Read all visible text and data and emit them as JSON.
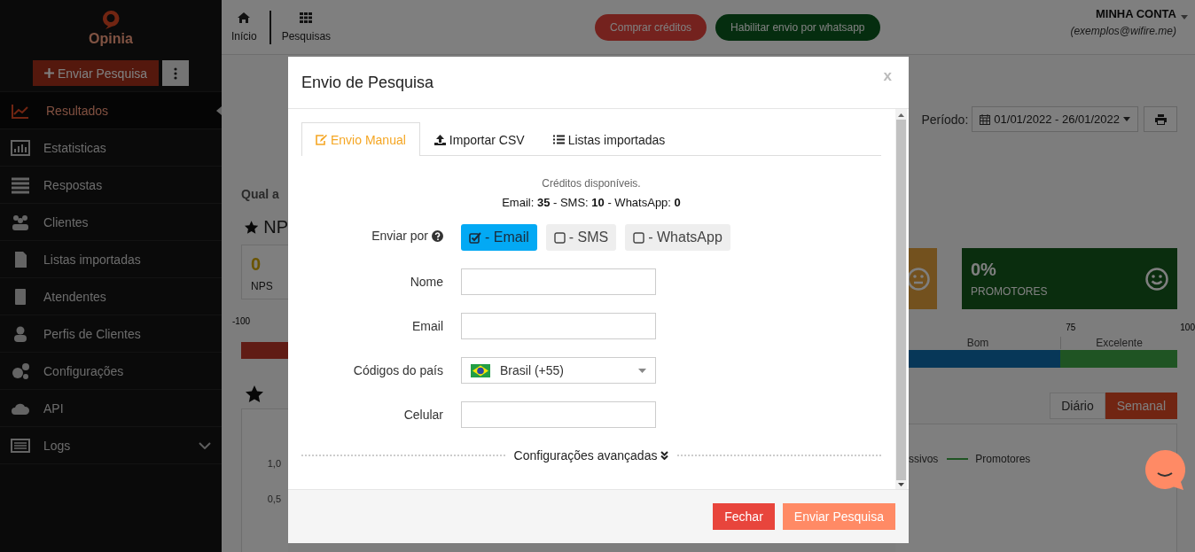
{
  "sidebar": {
    "logo": "Opinia",
    "send_button": "Enviar Pesquisa",
    "items": [
      {
        "label": "Resultados",
        "selected": true,
        "kind": "link"
      },
      {
        "label": "Estatisticas",
        "selected": false,
        "kind": "link"
      },
      {
        "label": "Respostas",
        "selected": false,
        "kind": "link"
      },
      {
        "label": "Clientes",
        "selected": false,
        "kind": "link"
      },
      {
        "label": "Listas importadas",
        "selected": false,
        "kind": "link"
      },
      {
        "label": "Atendentes",
        "selected": false,
        "kind": "link"
      },
      {
        "label": "Perfis de Clientes",
        "selected": false,
        "kind": "link"
      },
      {
        "label": "Configurações",
        "selected": false,
        "kind": "link"
      },
      {
        "label": "API",
        "selected": false,
        "kind": "link"
      },
      {
        "label": "Logs",
        "selected": false,
        "kind": "group"
      }
    ]
  },
  "topbar": {
    "nav": [
      {
        "label": "Início"
      },
      {
        "label": "Pesquisas"
      }
    ],
    "buttons": [
      {
        "label": "Comprar créditos",
        "kind": "danger"
      },
      {
        "label": "Habilitar envio por whatsapp",
        "kind": "success"
      }
    ],
    "account": {
      "title": "MINHA CONTA",
      "email": "(exemplos@wifire.me)"
    }
  },
  "page": {
    "question": "Qual a",
    "nps_heading": "NP",
    "period_label": "Período:",
    "period_value": "01/01/2022 - 26/01/2022",
    "nps_card": {
      "value": "0",
      "label": "NPS"
    },
    "promoters_card": {
      "value": "0%",
      "label": "PROMOTORES"
    },
    "scale": {
      "min": "-100",
      "ticks": [
        "75",
        "100"
      ],
      "zones": [
        "Bom",
        "Excelente"
      ]
    },
    "period_toggle": [
      {
        "label": "Diário",
        "selected": false
      },
      {
        "label": "Semanal",
        "selected": true
      }
    ],
    "chart": {
      "legend": [
        "ssivos",
        "Promotores"
      ],
      "yticks": [
        "1,0",
        "0,5"
      ]
    }
  },
  "modal": {
    "title": "Envio de Pesquisa",
    "close": "x",
    "tabs": [
      {
        "label": "Envio Manual",
        "selected": true
      },
      {
        "label": "Importar CSV",
        "selected": false
      },
      {
        "label": "Listas importadas",
        "selected": false
      }
    ],
    "credits_title": "Créditos disponíveis.",
    "credits": "Email: **35** - SMS: **10** - WhatsApp: **0**",
    "send_via": {
      "label": "Enviar por",
      "options": [
        {
          "label": "- Email",
          "checked": true
        },
        {
          "label": "- SMS",
          "checked": false
        },
        {
          "label": "- WhatsApp",
          "checked": false
        }
      ]
    },
    "fields": [
      {
        "label": "Nome",
        "kind": "text"
      },
      {
        "label": "Email",
        "kind": "text"
      },
      {
        "label": "Códigos do país",
        "kind": "select",
        "value": "Brasil (+55)"
      },
      {
        "label": "Celular",
        "kind": "text"
      }
    ],
    "advanced": "Configurações avançadas",
    "buttons": [
      {
        "label": "Fechar",
        "kind": "danger"
      },
      {
        "label": "Enviar Pesquisa",
        "kind": "primary"
      }
    ]
  }
}
